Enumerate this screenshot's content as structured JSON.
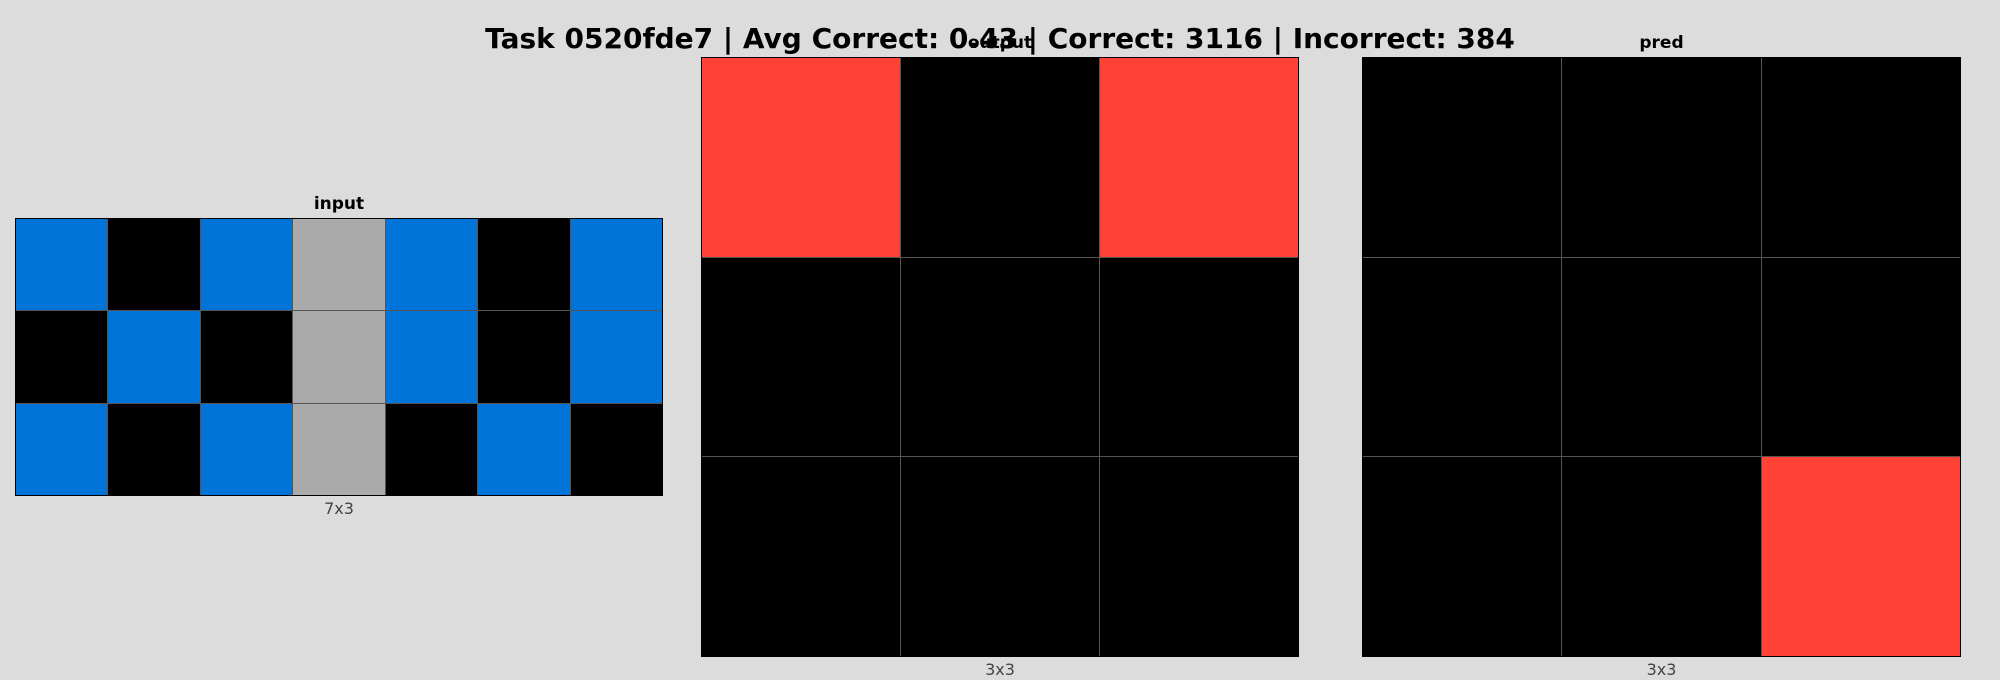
{
  "title": "Task 0520fde7 | Avg Correct: 0.43 | Correct: 3116 | Incorrect: 384",
  "palette": {
    "0": "#000000",
    "1": "#0074d9",
    "2": "#ff4136",
    "5": "#aaaaaa"
  },
  "panels": {
    "input": {
      "title": "input",
      "dims": "7x3",
      "rows": [
        [
          1,
          0,
          1,
          5,
          1,
          0,
          1
        ],
        [
          0,
          1,
          0,
          5,
          1,
          0,
          1
        ],
        [
          1,
          0,
          1,
          5,
          0,
          1,
          0
        ]
      ]
    },
    "output": {
      "title": "output",
      "dims": "3x3",
      "rows": [
        [
          2,
          0,
          2
        ],
        [
          0,
          0,
          0
        ],
        [
          0,
          0,
          0
        ]
      ]
    },
    "pred": {
      "title": "pred",
      "dims": "3x3",
      "rows": [
        [
          0,
          0,
          0
        ],
        [
          0,
          0,
          0
        ],
        [
          0,
          0,
          2
        ]
      ]
    }
  }
}
